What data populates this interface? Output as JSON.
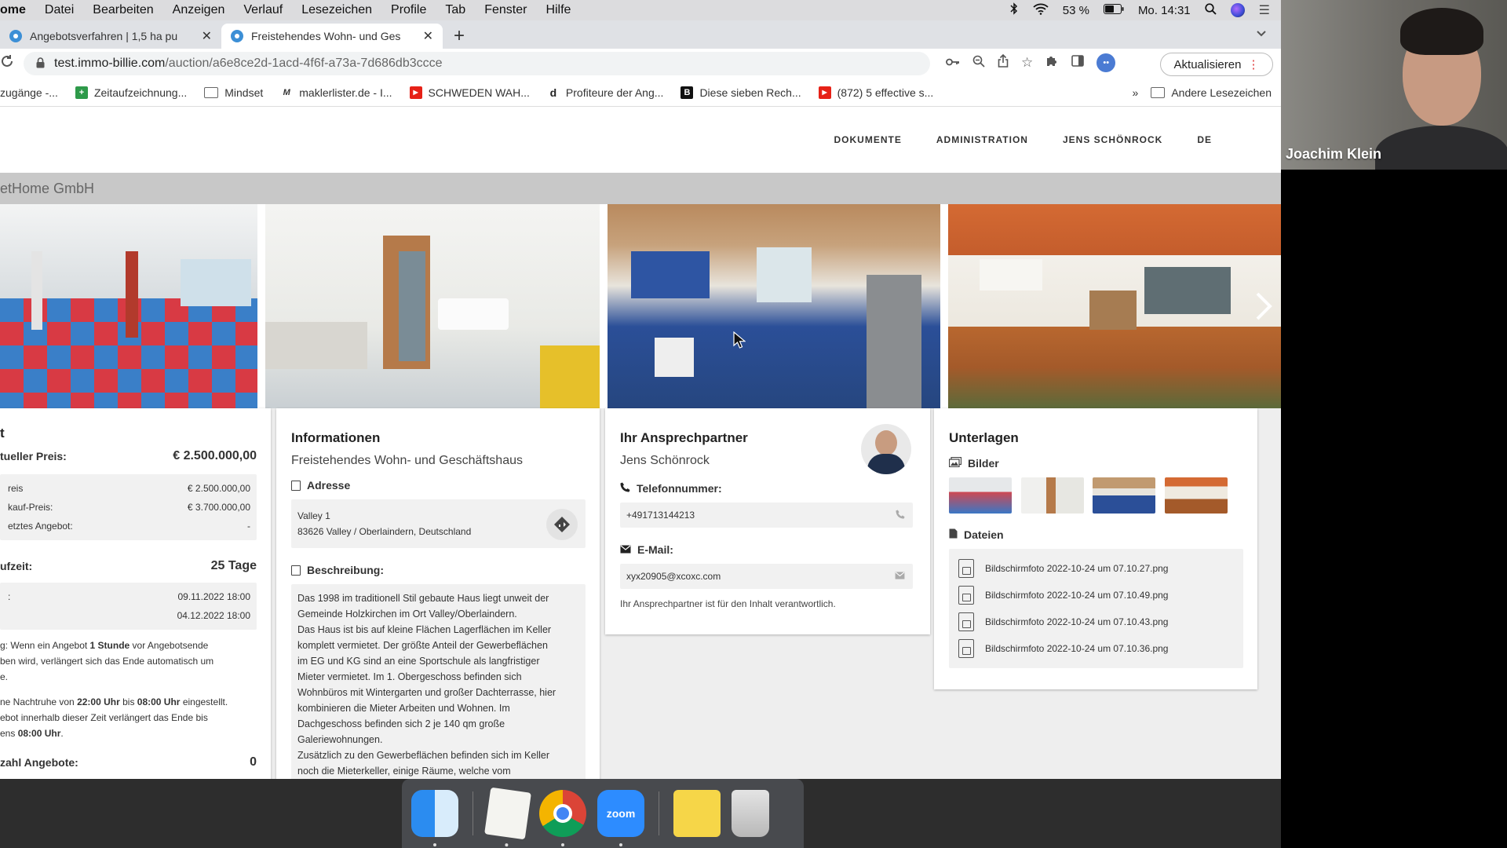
{
  "menubar": {
    "app": "ome",
    "items": [
      "Datei",
      "Bearbeiten",
      "Anzeigen",
      "Verlauf",
      "Lesezeichen",
      "Profile",
      "Tab",
      "Fenster",
      "Hilfe"
    ],
    "battery": "53 %",
    "clock": "Mo. 14:31"
  },
  "tabs": [
    {
      "title": "Angebotsverfahren | 1,5 ha pu"
    },
    {
      "title": "Freistehendes Wohn- und Ges"
    }
  ],
  "address": {
    "host": "test.immo-billie.com",
    "path": "/auction/a6e8ce2d-1acd-4f6f-a73a-7d686db3ccce",
    "update_label": "Aktualisieren"
  },
  "bookmarks": {
    "items": [
      {
        "label": "zugänge -..."
      },
      {
        "label": "Zeitaufzeichnung..."
      },
      {
        "label": "Mindset"
      },
      {
        "label": "maklerlister.de - I..."
      },
      {
        "label": "SCHWEDEN WAH..."
      },
      {
        "label": "Profiteure der Ang..."
      },
      {
        "label": "Diese sieben Rech..."
      },
      {
        "label": "(872) 5 effective s..."
      }
    ],
    "more": "»",
    "other": "Andere Lesezeichen"
  },
  "nav": {
    "documents": "DOKUMENTE",
    "admin": "ADMINISTRATION",
    "user": "JENS SCHÖNROCK",
    "lang": "DE"
  },
  "company": "etHome GmbH",
  "auction": {
    "title": "t",
    "current_price_label": "tueller Preis:",
    "current_price": "€ 2.500.000,00",
    "rows": [
      {
        "label": "reis",
        "value": "€ 2.500.000,00"
      },
      {
        "label": "kauf-Preis:",
        "value": "€ 3.700.000,00"
      },
      {
        "label": "etztes Angebot:",
        "value": "-"
      }
    ],
    "runtime_label": "ufzeit:",
    "runtime": "25 Tage",
    "start_label": ":",
    "start": "09.11.2022 18:00",
    "end": "04.12.2022 18:00",
    "note1_a": "g: Wenn ein Angebot ",
    "note1_b": "1 Stunde",
    "note1_c": " vor Angebotsende",
    "note1_line2": "ben wird, verlängert sich das Ende automatisch um",
    "note1_line3": "e.",
    "note2_a": "ne Nachtruhe von ",
    "note2_b": "22:00 Uhr",
    "note2_c": " bis ",
    "note2_d": "08:00 Uhr",
    "note2_e": " eingestellt.",
    "note2_line2": "ebot innerhalb dieser Zeit verlängert das Ende bis",
    "note2_line3_a": "ens ",
    "note2_line3_b": "08:00 Uhr",
    "note2_line3_c": ".",
    "bids_label": "zahl Angebote:",
    "bids": "0"
  },
  "info": {
    "title": "Informationen",
    "subtitle": "Freistehendes Wohn- und Geschäftshaus",
    "address_label": "Adresse",
    "street": "Valley 1",
    "city": "83626 Valley / Oberlaindern, Deutschland",
    "desc_label": "Beschreibung:",
    "desc_lines": [
      "Das 1998 im traditionell Stil gebaute Haus liegt unweit der",
      "Gemeinde Holzkirchen im Ort Valley/Oberlaindern.",
      "Das Haus ist bis auf kleine Flächen Lagerflächen im Keller",
      "komplett vermietet. Der größte Anteil der Gewerbeflächen",
      "im EG und KG sind an eine Sportschule als langfristiger",
      "Mieter vermietet. Im 1. Obergeschoss befinden sich",
      "Wohnbüros mit Wintergarten und großer Dachterrasse, hier",
      "kombinieren die Mieter Arbeiten und Wohnen. Im",
      "Dachgeschoss befinden sich 2 je 140 qm große",
      "Galeriewohnungen.",
      "Zusätzlich zu den Gewerbeflächen befinden sich im Keller",
      "noch die Mieterkeller, einige Räume, welche vom"
    ]
  },
  "contact": {
    "title": "Ihr Ansprechpartner",
    "name": "Jens Schönrock",
    "phone_label": "Telefonnummer:",
    "phone": "+491713144213",
    "email_label": "E-Mail:",
    "email": "xyx20905@xcoxc.com",
    "note": "Ihr Ansprechpartner ist für den Inhalt verantwortlich."
  },
  "docs": {
    "title": "Unterlagen",
    "images_label": "Bilder",
    "files_label": "Dateien",
    "files": [
      "Bildschirmfoto 2022-10-24 um 07.10.27.png",
      "Bildschirmfoto 2022-10-24 um 07.10.49.png",
      "Bildschirmfoto 2022-10-24 um 07.10.43.png",
      "Bildschirmfoto 2022-10-24 um 07.10.36.png"
    ]
  },
  "dock": {
    "zoom_label": "zoom"
  },
  "webcam": {
    "name": "Joachim Klein"
  }
}
